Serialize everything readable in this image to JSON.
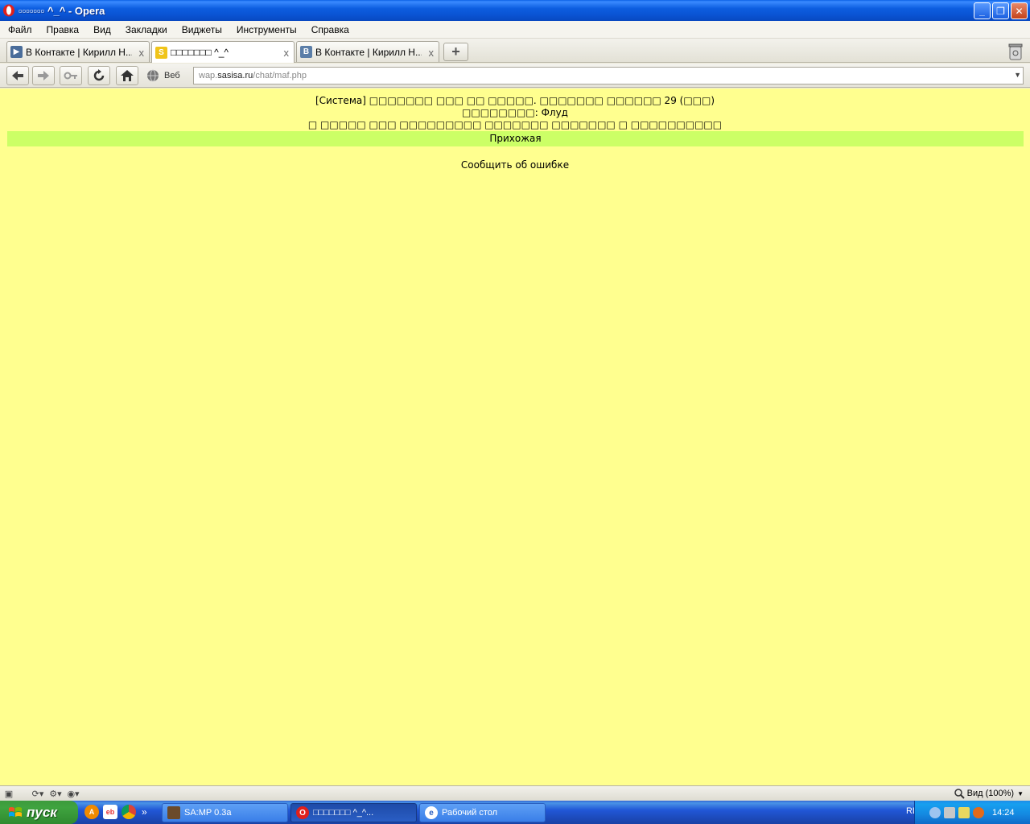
{
  "window": {
    "title": "▫▫▫▫▫▫▫ ^_^ - Opera",
    "buttons": {
      "minimize": "_",
      "maximize": "❐",
      "close": "✕"
    }
  },
  "menu": {
    "items": [
      "Файл",
      "Правка",
      "Вид",
      "Закладки",
      "Виджеты",
      "Инструменты",
      "Справка"
    ]
  },
  "tabs": [
    {
      "label": "В Контакте | Кирилл Н...",
      "icon": "play-icon",
      "active": false
    },
    {
      "label": "□□□□□□□ ^_^",
      "icon": "s-favicon",
      "active": true
    },
    {
      "label": "В Контакте | Кирилл Н...",
      "icon": "vk-favicon",
      "active": false
    }
  ],
  "tab_close_glyph": "x",
  "new_tab_glyph": "+",
  "address": {
    "search_engine": "Веб",
    "url_prefix": "wap.",
    "url_domain": "sasisa.ru",
    "url_path": "/chat/maf.php"
  },
  "page": {
    "line1": "[Система] □□□□□□□ □□□ □□ □□□□□. □□□□□□□ □□□□□□ 29 (□□□)",
    "line2": "□□□□□□□□: Флуд",
    "line3": "□ □□□□□ □□□ □□□□□□□□□ □□□□□□□ □□□□□□□ □ □□□□□□□□□□",
    "room": "Прихожая",
    "report_link": "Сообщить об ошибке",
    "background_color": "#ffff8f",
    "room_bar_color": "#ccff66"
  },
  "status": {
    "zoom_label": "Вид (100%)"
  },
  "taskbar": {
    "start_label": "пуск",
    "quick_launch_more": "»",
    "tasks": [
      {
        "label": "SA:MP 0.3a",
        "active": false
      },
      {
        "label": "□□□□□□□ ^_^...",
        "active": true
      },
      {
        "label": "Рабочий стол",
        "active": false
      }
    ],
    "tray": {
      "language": "RL",
      "time": "14:24"
    }
  }
}
